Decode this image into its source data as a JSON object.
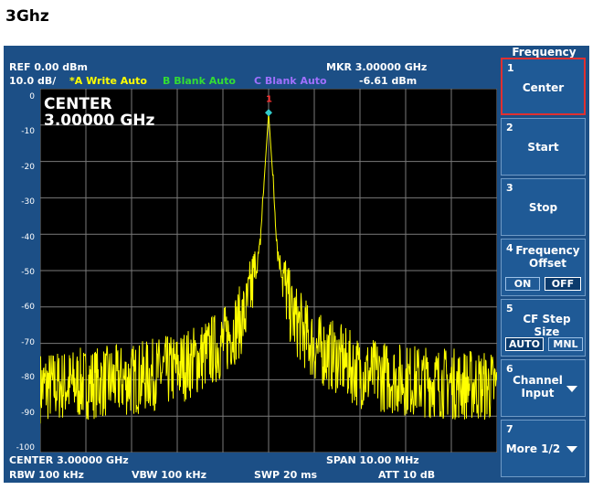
{
  "page_title": "3Ghz",
  "header": {
    "ref": "REF  0.00 dBm",
    "scale": "10.0 dB/",
    "trace_a": "*A Write Auto",
    "trace_b": "B Blank Auto",
    "trace_c": "C Blank Auto",
    "marker_freq": "MKR 3.00000 GHz",
    "marker_level": "-6.61 dBm"
  },
  "plot": {
    "y_ticks": [
      "0",
      "-10",
      "-20",
      "-30",
      "-40",
      "-50",
      "-60",
      "-70",
      "-80",
      "-90",
      "-100"
    ],
    "center_label_line1": "CENTER",
    "center_label_line2": "3.00000 GHz",
    "marker_number": "1",
    "colors": {
      "trace": "#ffff00",
      "grid": "#7a7a7a",
      "marker": "#33cccc",
      "marker_flag": "#ff3333"
    }
  },
  "chart_data": {
    "type": "line",
    "x_unit": "GHz",
    "y_unit": "dBm",
    "xlim": [
      2.995,
      3.005
    ],
    "ylim": [
      -100,
      0
    ],
    "grid": true,
    "series": [
      {
        "x": [
          2.995,
          2.996,
          2.997,
          2.998,
          2.9985,
          2.999,
          2.9995,
          2.9998,
          3.0,
          3.0002,
          3.0005,
          3.001,
          3.0015,
          3.002,
          3.003,
          3.004,
          3.005
        ],
        "y": [
          -82,
          -81,
          -80,
          -77,
          -74,
          -70,
          -62,
          -45,
          -6.61,
          -45,
          -62,
          -71,
          -74,
          -78,
          -80,
          -81,
          -82
        ]
      }
    ],
    "marker": {
      "x": 3.0,
      "y": -6.61
    }
  },
  "footer": {
    "center": "CENTER 3.00000 GHz",
    "span": "SPAN 10.00 MHz",
    "rbw": "RBW  100 kHz",
    "vbw": "VBW  100 kHz",
    "swp": "SWP  20 ms",
    "att": "ATT 10 dB"
  },
  "softkeys": {
    "title": "Frequency",
    "keys": [
      {
        "num": "1",
        "label": "Center"
      },
      {
        "num": "2",
        "label": "Start"
      },
      {
        "num": "3",
        "label": "Stop"
      },
      {
        "num": "4",
        "label": "Frequency Offset",
        "opt_on": "ON",
        "opt_off": "OFF"
      },
      {
        "num": "5",
        "label": "CF Step Size",
        "opt_auto": "AUTO",
        "opt_mnl": "MNL"
      },
      {
        "num": "6",
        "label": "Channel Input"
      },
      {
        "num": "7",
        "label": "More 1/2"
      }
    ]
  }
}
